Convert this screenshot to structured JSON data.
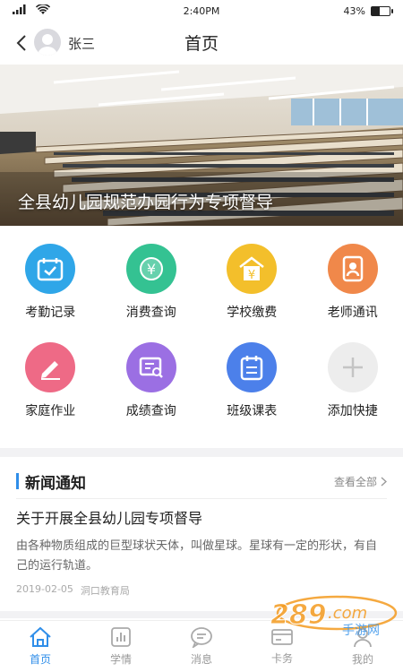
{
  "status_bar": {
    "time": "2:40PM",
    "battery": "43%",
    "battery_level": 0.43
  },
  "header": {
    "user_name": "张三",
    "title": "首页"
  },
  "banner": {
    "caption": "全县幼儿园规范办园行为专项督导"
  },
  "functions": [
    {
      "label": "考勤记录",
      "icon": "calendar-check-icon",
      "color": "#2fa6e8"
    },
    {
      "label": "消费查询",
      "icon": "yuan-coin-icon",
      "color": "#34c292"
    },
    {
      "label": "学校缴费",
      "icon": "school-payment-icon",
      "color": "#f3bf2b"
    },
    {
      "label": "老师通讯",
      "icon": "contacts-book-icon",
      "color": "#f0884a"
    },
    {
      "label": "家庭作业",
      "icon": "homework-pencil-icon",
      "color": "#ee6a86"
    },
    {
      "label": "成绩查询",
      "icon": "grade-search-icon",
      "color": "#9b6fe3"
    },
    {
      "label": "班级课表",
      "icon": "class-schedule-icon",
      "color": "#4c80ea"
    },
    {
      "label": "添加快捷",
      "icon": "add-shortcut-icon",
      "color": "#ededed"
    }
  ],
  "news": {
    "section_title": "新闻通知",
    "view_all": "查看全部",
    "article": {
      "title": "关于开展全县幼儿园专项督导",
      "summary": "由各种物质组成的巨型球状天体，叫做星球。星球有一定的形状，有自己的运行轨道。",
      "date": "2019-02-05",
      "source": "洞口教育局"
    }
  },
  "tabs": [
    {
      "label": "首页",
      "icon": "home-icon",
      "active": true
    },
    {
      "label": "学情",
      "icon": "chart-icon",
      "active": false
    },
    {
      "label": "消息",
      "icon": "message-icon",
      "active": false
    },
    {
      "label": "卡务",
      "icon": "card-icon",
      "active": false
    },
    {
      "label": "我的",
      "icon": "profile-icon",
      "active": false
    }
  ],
  "watermark": {
    "text": "289",
    "subtext": "手游网"
  },
  "colors": {
    "accent": "#2f8ee9"
  }
}
